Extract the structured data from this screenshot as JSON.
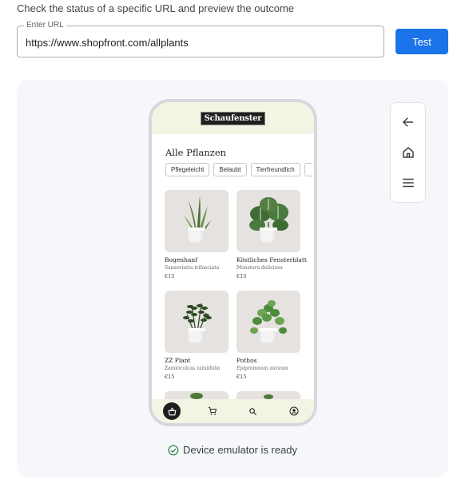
{
  "instruction": "Check the status of a specific URL and preview the outcome",
  "url": {
    "label": "Enter URL",
    "value": "https://www.shopfront.com/allplants"
  },
  "test_button": "Test",
  "phone": {
    "logo": "Schaufenster",
    "page_title": "Alle Pflanzen",
    "filters": [
      "Pflegeleicht",
      "Belaubt",
      "Tierfreundlich"
    ],
    "products": [
      {
        "name": "Bogenhanf",
        "latin": "Sansevieria trifasciata",
        "price": "€15"
      },
      {
        "name": "Köstliches Fensterblatt",
        "latin": "Monstera deliciosa",
        "price": "€15"
      },
      {
        "name": "ZZ Plant",
        "latin": "Zamioculcas zamiifolia",
        "price": "€15"
      },
      {
        "name": "Pothos",
        "latin": "Epipremnum aureum",
        "price": "€15"
      }
    ],
    "nav_icons": [
      "basket-icon",
      "cart-icon",
      "search-icon",
      "account-icon"
    ]
  },
  "side_controls": [
    "back-arrow-icon",
    "home-icon",
    "menu-icon"
  ],
  "status": {
    "text": "Device emulator is ready",
    "color": "#188038"
  },
  "colors": {
    "accent": "#1a73e8",
    "phone_header": "#f4f4e4"
  }
}
